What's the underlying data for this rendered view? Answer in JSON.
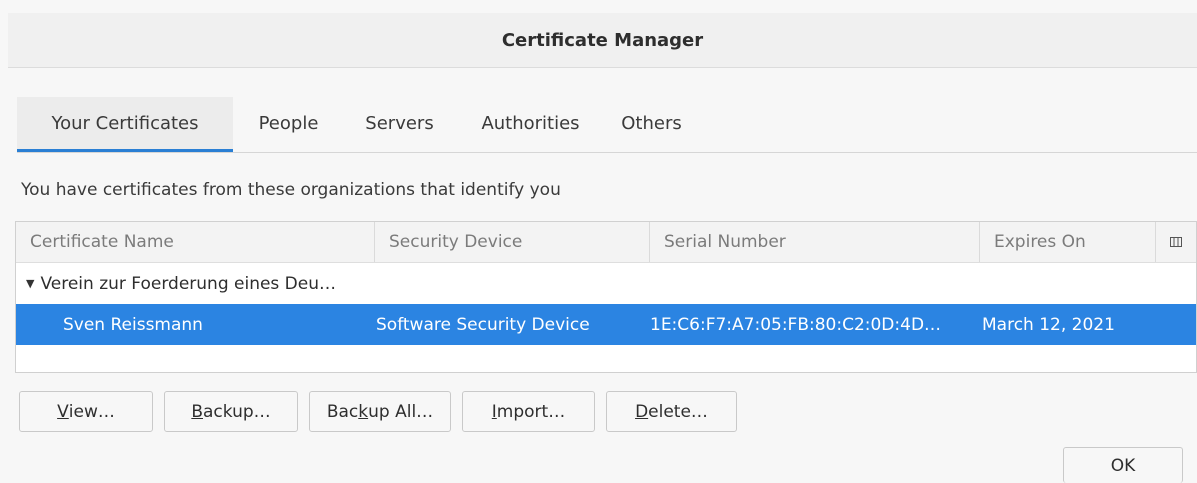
{
  "window": {
    "title": "Certificate Manager"
  },
  "tabs": [
    {
      "label": "Your Certificates",
      "selected": true
    },
    {
      "label": "People"
    },
    {
      "label": "Servers"
    },
    {
      "label": "Authorities"
    },
    {
      "label": "Others"
    }
  ],
  "description": "You have certificates from these organizations that identify you",
  "table": {
    "columns": [
      "Certificate Name",
      "Security Device",
      "Serial Number",
      "Expires On"
    ],
    "column_picker_icon": "column-picker-icon",
    "group": {
      "label": "Verein zur Foerderung eines Deu…",
      "expanded": true
    },
    "rows": [
      {
        "name": "Sven Reissmann",
        "device": "Software Security Device",
        "serial": "1E:C6:F7:A7:05:FB:80:C2:0D:4D…",
        "expires": "March 12, 2021",
        "selected": true
      }
    ]
  },
  "buttons": {
    "view": {
      "pre": "",
      "acc": "V",
      "post": "iew…"
    },
    "backup": {
      "pre": "",
      "acc": "B",
      "post": "ackup…"
    },
    "backup_all": {
      "pre": "Bac",
      "acc": "k",
      "post": "up All…"
    },
    "import": {
      "pre": "",
      "acc": "I",
      "post": "mport…"
    },
    "delete": {
      "pre": "",
      "acc": "D",
      "post": "elete…"
    },
    "ok": "OK"
  },
  "colors": {
    "accent": "#2b84e2",
    "tab_indicator": "#2a7fd4"
  }
}
